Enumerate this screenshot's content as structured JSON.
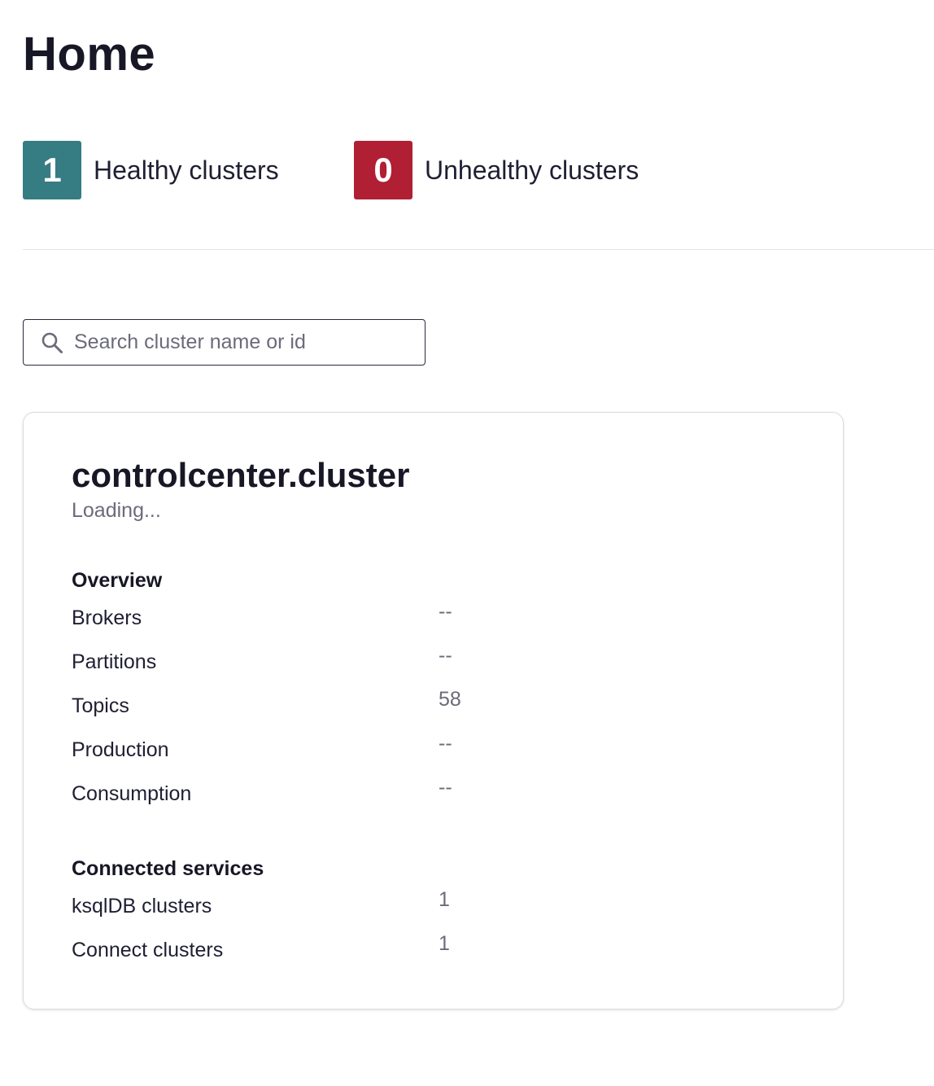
{
  "page": {
    "title": "Home"
  },
  "stats": {
    "healthy": {
      "count": "1",
      "label": "Healthy clusters",
      "color": "#367c83"
    },
    "unhealthy": {
      "count": "0",
      "label": "Unhealthy clusters",
      "color": "#b01f33"
    }
  },
  "search": {
    "placeholder": "Search cluster name or id",
    "value": ""
  },
  "cluster": {
    "name": "controlcenter.cluster",
    "status": "Loading...",
    "overview": {
      "title": "Overview",
      "rows": [
        {
          "label": "Brokers",
          "value": "--"
        },
        {
          "label": "Partitions",
          "value": "--"
        },
        {
          "label": "Topics",
          "value": "58"
        },
        {
          "label": "Production",
          "value": "--"
        },
        {
          "label": "Consumption",
          "value": "--"
        }
      ]
    },
    "services": {
      "title": "Connected services",
      "rows": [
        {
          "label": "ksqlDB clusters",
          "value": "1"
        },
        {
          "label": "Connect clusters",
          "value": "1"
        }
      ]
    }
  }
}
